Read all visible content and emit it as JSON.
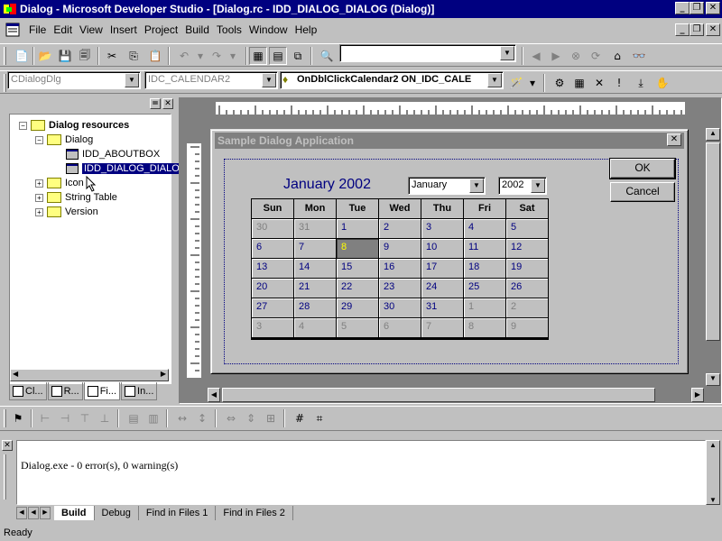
{
  "window": {
    "title": "Dialog - Microsoft Developer Studio - [Dialog.rc - IDD_DIALOG_DIALOG (Dialog)]",
    "minimize": "_",
    "restore": "❐",
    "close": "✕"
  },
  "menu": [
    "File",
    "Edit",
    "View",
    "Insert",
    "Project",
    "Build",
    "Tools",
    "Window",
    "Help"
  ],
  "toolbar": {
    "find_value": ""
  },
  "wizardbar": {
    "class_combo": "CDialogDlg",
    "id_combo": "IDC_CALENDAR2",
    "member_combo": "OnDblClickCalendar2  ON_IDC_CALE"
  },
  "workspace": {
    "tree": {
      "root": "Dialog resources",
      "dialog_folder": "Dialog",
      "dialog_items": [
        "IDD_ABOUTBOX",
        "IDD_DIALOG_DIALOG"
      ],
      "folders": [
        "Icon",
        "String Table",
        "Version"
      ]
    },
    "tabs": [
      "Cl...",
      "R...",
      "Fi...",
      "In..."
    ]
  },
  "sample_dialog": {
    "title": "Sample Dialog Application",
    "ok_label": "OK",
    "cancel_label": "Cancel",
    "calendar": {
      "title": "January 2002",
      "month_select": "January",
      "year_select": "2002",
      "days": [
        "Sun",
        "Mon",
        "Tue",
        "Wed",
        "Thu",
        "Fri",
        "Sat"
      ],
      "rows": [
        [
          "30",
          "31",
          "1",
          "2",
          "3",
          "4",
          "5"
        ],
        [
          "6",
          "7",
          "8",
          "9",
          "10",
          "11",
          "12"
        ],
        [
          "13",
          "14",
          "15",
          "16",
          "17",
          "18",
          "19"
        ],
        [
          "20",
          "21",
          "22",
          "23",
          "24",
          "25",
          "26"
        ],
        [
          "27",
          "28",
          "29",
          "30",
          "31",
          "1",
          "2"
        ],
        [
          "3",
          "4",
          "5",
          "6",
          "7",
          "8",
          "9"
        ]
      ],
      "today": "8"
    }
  },
  "output": {
    "text": "Dialog.exe - 0 error(s), 0 warning(s)",
    "tabs": [
      "Build",
      "Debug",
      "Find in Files 1",
      "Find in Files 2"
    ]
  },
  "status": "Ready"
}
